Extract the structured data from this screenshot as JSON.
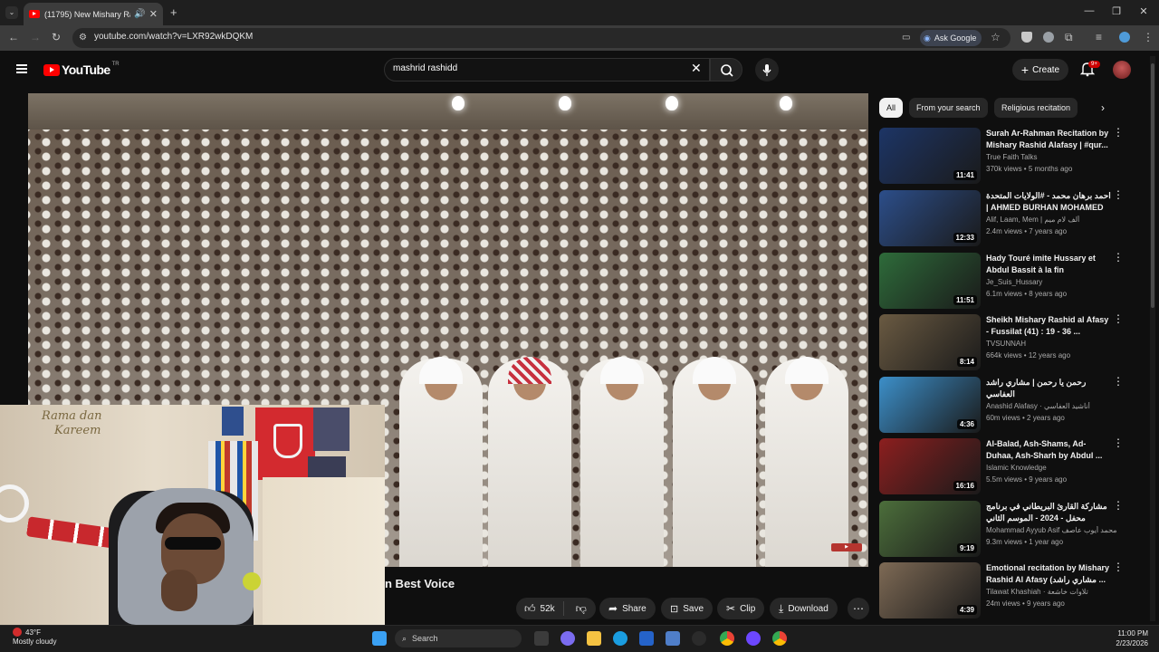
{
  "browser": {
    "tab_title": "(11795) New Mishary Rashi...",
    "url": "youtube.com/watch?v=LXR92wkDQKM",
    "ask_google": "Ask Google"
  },
  "header": {
    "logo_text": "YouTube",
    "country": "TR",
    "search_value": "mashrid rashidd",
    "create_label": "Create",
    "notifications_badge": "9+"
  },
  "video": {
    "title_visible": "n Best Voice",
    "likes": "52k",
    "share_label": "Share",
    "save_label": "Save",
    "clip_label": "Clip",
    "download_label": "Download"
  },
  "webcam": {
    "banner_line1": "Rama dan",
    "banner_line2": "Kareem"
  },
  "chips": [
    "All",
    "From your search",
    "Religious recitation"
  ],
  "recommendations": [
    {
      "title": "Surah Ar-Rahman Recitation by Mishary Rashid Alafasy | #qur...",
      "channel": "True Faith Talks",
      "meta": "370k views • 5 months ago",
      "duration": "11:41",
      "thumb_color": "#1d3566"
    },
    {
      "title": "احمد برهان محمد - #الولايات المتحدة | AHMED BURHAN MOHAMED -...",
      "channel": "Alif, Laam, Mem | ألف لام ميم",
      "meta": "2.4m views • 7 years ago",
      "duration": "12:33",
      "thumb_color": "#2c4e8a"
    },
    {
      "title": "Hady Touré imite Hussary et Abdul Bassit à la fin",
      "channel": "Je_Suis_Hussary",
      "meta": "6.1m views • 8 years ago",
      "duration": "11:51",
      "thumb_color": "#2e6b3a"
    },
    {
      "title": "Sheikh Mishary Rashid al Afasy - Fussilat (41) : 19 - 36 ...",
      "channel": "TVSUNNAH",
      "meta": "664k views • 12 years ago",
      "duration": "8:14",
      "thumb_color": "#6a5a42"
    },
    {
      "title": "رحمن يا رحمن | مشاري راشد العفاسي",
      "channel": "Anashid Alafasy · أناشيد العفاسي",
      "meta": "60m views • 2 years ago",
      "duration": "4:36",
      "thumb_color": "#3c8fc9"
    },
    {
      "title": "Al-Balad, Ash-Shams, Ad-Duhaa, Ash-Sharh by Abdul ...",
      "channel": "Islamic Knowledge",
      "meta": "5.5m views • 9 years ago",
      "duration": "16:16",
      "thumb_color": "#8c1f1f"
    },
    {
      "title": "مشاركة القارئ البريطاني في برنامج محفل - 2024 - الموسم الثاني",
      "channel": "Mohammad Ayyub Asif محمد أيوب عاصف",
      "meta": "9.3m views • 1 year ago",
      "duration": "9:19",
      "thumb_color": "#4c6e3b"
    },
    {
      "title": "Emotional recitation by Mishary Rashid Al Afasy (مشاري راشد ...",
      "channel": "Tilawat Khashiah · تلاوات خاشعة",
      "meta": "24m views • 9 years ago",
      "duration": "4:39",
      "thumb_color": "#7e6a55"
    }
  ],
  "taskbar": {
    "temperature": "43°F",
    "weather": "Mostly cloudy",
    "search_placeholder": "Search",
    "time": "11:00 PM",
    "date": "2/23/2026"
  },
  "colors": {
    "accent": "#ff0000",
    "background": "#0f0f0f",
    "chip_bg": "#272727"
  }
}
